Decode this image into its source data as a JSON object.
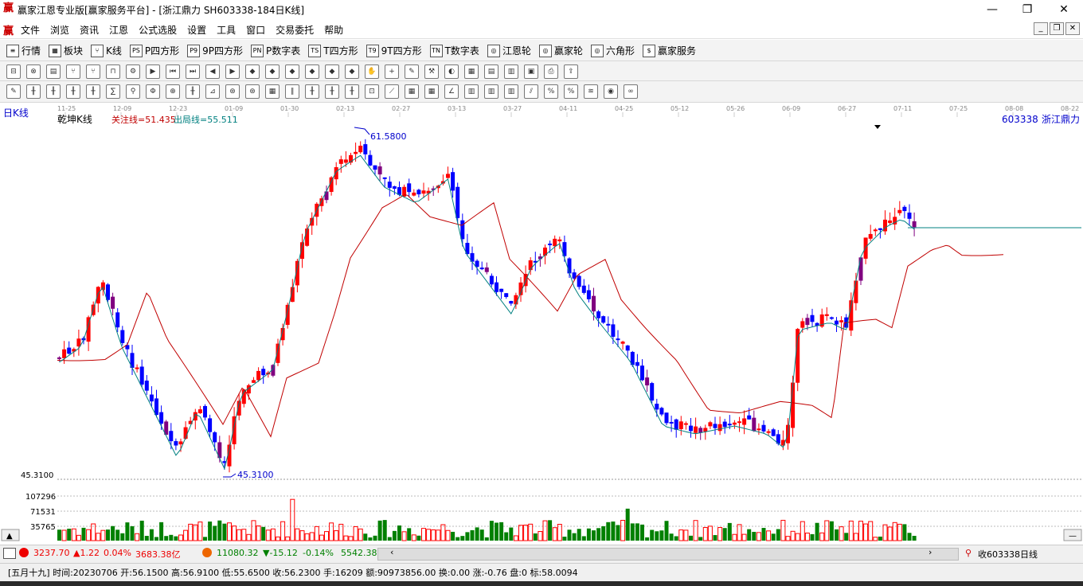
{
  "window": {
    "title": "赢家江恩专业版[赢家服务平台] - [浙江鼎力  SH603338-184日K线]",
    "minimize": "—",
    "maximize": "❐",
    "close": "✕"
  },
  "menu": [
    "文件",
    "浏览",
    "资讯",
    "江恩",
    "公式选股",
    "设置",
    "工具",
    "窗口",
    "交易委托",
    "帮助"
  ],
  "toolbar1": [
    "行情",
    "板块",
    "K线",
    "P四方形",
    "9P四方形",
    "P数字表",
    "T四方形",
    "9T四方形",
    "T数字表",
    "江恩轮",
    "赢家轮",
    "六角形",
    "赢家服务"
  ],
  "toolbar1_icons": [
    "≡",
    "▦",
    "⑂",
    "PS",
    "P9",
    "PN",
    "TS",
    "T9",
    "TN",
    "◎",
    "◎",
    "◎",
    "$"
  ],
  "chart": {
    "period_label": "日K线",
    "indicator_label": "乾坤K线",
    "focus_line": "关注线=51.435",
    "exit_line": "出局线=55.511",
    "stock_code": "603338",
    "stock_name": "浙江鼎力",
    "high_mark": "61.5800",
    "low_mark": "45.3100",
    "price_axis_label": "45.3100",
    "volume_ticks": [
      "107296",
      "71531",
      "35765"
    ],
    "dates": [
      "11-25",
      "12-09",
      "12-23",
      "01-09",
      "01-30",
      "02-13",
      "02-27",
      "03-13",
      "03-27",
      "04-11",
      "04-25",
      "05-12",
      "05-26",
      "06-09",
      "06-27",
      "07-11",
      "07-25",
      "08-08",
      "08-22"
    ],
    "colors": {
      "up": "#ff0000",
      "down": "#0000ff",
      "purple": "#800080",
      "vol_up": "#ff0000",
      "vol_down": "#008000",
      "ma_short": "#008080",
      "ma_long": "#c00000"
    }
  },
  "status": {
    "sh_index": "3237.70",
    "sh_change": "▲1.22",
    "sh_pct": "0.04%",
    "sh_amount": "3683.38亿",
    "sz_index": "11080.32",
    "sz_change": "▼-15.12",
    "sz_pct": "-0.14%",
    "sz_amount": "5542.38",
    "right_label": "收603338日线"
  },
  "info_line": "[五月十九] 时间:20230706 开:56.1500 高:56.9100 低:55.6500 收:56.2300 手:16209 额:90973856.00 换:0.00 涨:-0.76 盘:0 标:58.0094"
}
